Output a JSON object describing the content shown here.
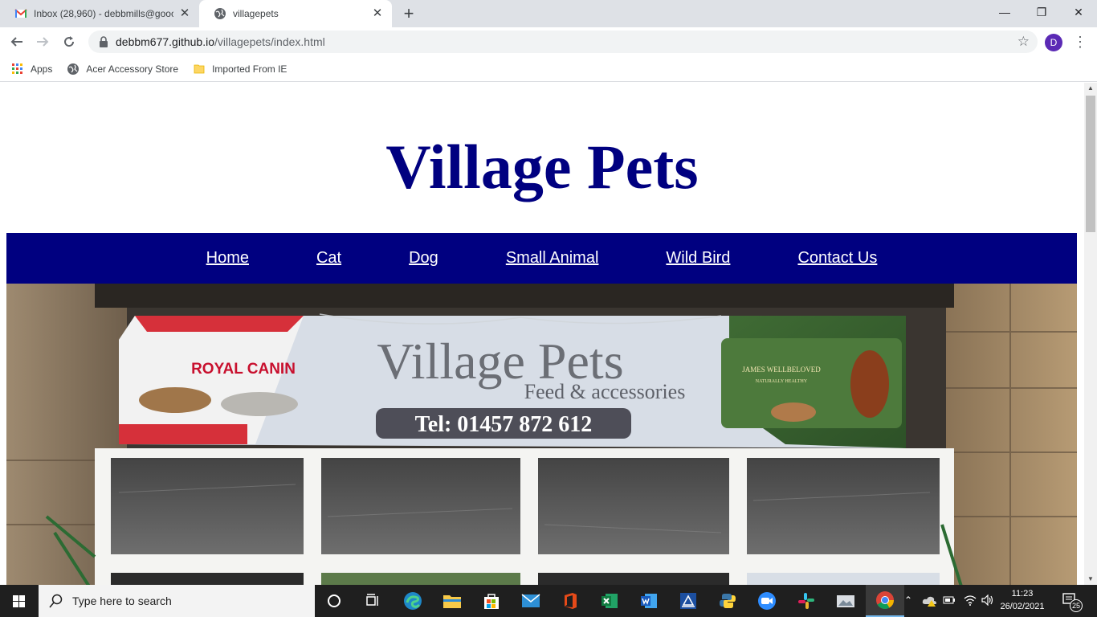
{
  "browser": {
    "tabs": [
      {
        "title": "Inbox (28,960) - debbmills@gooc",
        "icon": "gmail-icon",
        "active": false
      },
      {
        "title": "villagepets",
        "icon": "globe-icon",
        "active": true
      }
    ],
    "new_tab_label": "+",
    "url_host": "debbm677.github.io",
    "url_path": "/villagepets/index.html",
    "profile_initial": "D",
    "bookmarks": [
      {
        "label": "Apps",
        "icon": "apps-grid-icon"
      },
      {
        "label": "Acer Accessory Store",
        "icon": "globe-icon"
      },
      {
        "label": "Imported From IE",
        "icon": "folder-icon"
      }
    ]
  },
  "page": {
    "title": "Village Pets",
    "nav": [
      "Home",
      "Cat",
      "Dog",
      "Small Animal",
      "Wild Bird",
      "Contact Us"
    ],
    "hero": {
      "sign_title": "Village Pets",
      "sign_subtitle": "Feed & accessories",
      "sign_phone": "Tel:  01457 872 612",
      "left_brand": "ROYAL CANIN",
      "right_brand": "JAMES WELLBELOVED",
      "right_brand_sub": "NATURALLY HEALTHY"
    }
  },
  "taskbar": {
    "search_placeholder": "Type here to search",
    "time": "11:23",
    "date": "26/02/2021",
    "notification_count": "25"
  },
  "colors": {
    "brand_navy": "#000080",
    "chrome_tabstrip": "#dee1e6",
    "taskbar": "#1f1f1f"
  }
}
